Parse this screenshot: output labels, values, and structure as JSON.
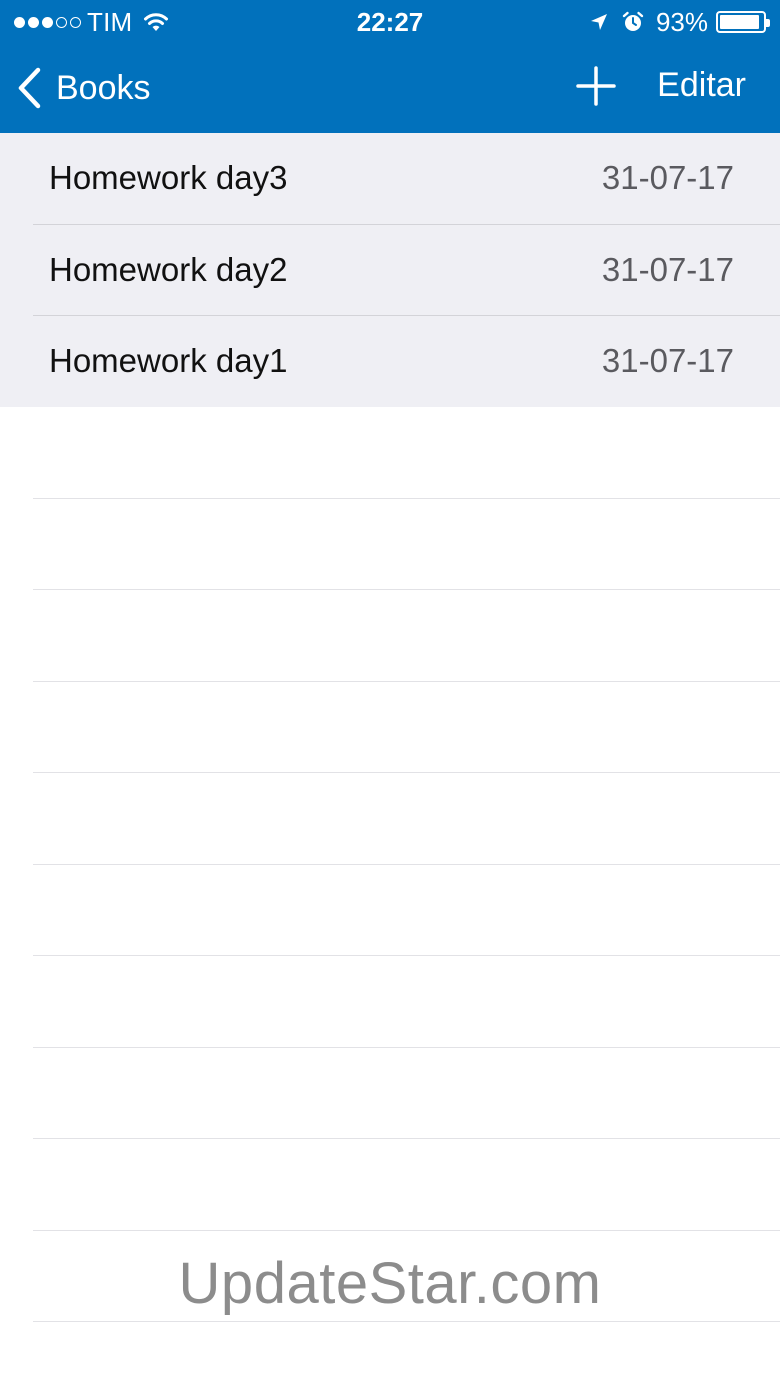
{
  "status_bar": {
    "carrier": "TIM",
    "signal_bars_filled": 3,
    "signal_bars_total": 5,
    "time": "22:27",
    "battery_percent_label": "93%",
    "battery_level": 0.93,
    "icons": [
      "signal-dots-icon",
      "wifi-icon",
      "location-arrow-icon",
      "alarm-clock-icon",
      "battery-icon"
    ]
  },
  "nav": {
    "back_label": "Books",
    "add_icon": "plus-icon",
    "edit_label": "Editar"
  },
  "list": {
    "items": [
      {
        "title": "Homework day3",
        "date": "31-07-17"
      },
      {
        "title": "Homework day2",
        "date": "31-07-17"
      },
      {
        "title": "Homework day1",
        "date": "31-07-17"
      }
    ]
  },
  "watermark": "UpdateStar.com",
  "colors": {
    "header": "#0171bc",
    "row_background": "#efeff4",
    "separator": "#d3d3d8",
    "date_text": "#5a5a5f"
  }
}
